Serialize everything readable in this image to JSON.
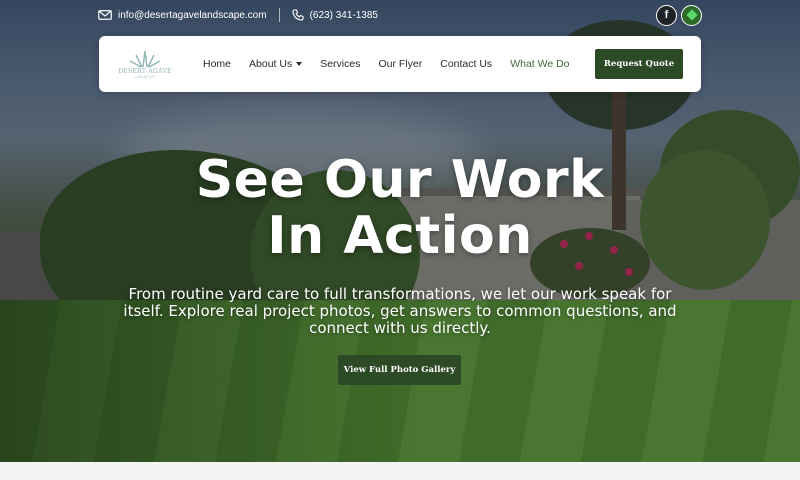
{
  "topbar": {
    "email": "info@desertagavelandscape.com",
    "phone": "(623) 341-1385",
    "icons": {
      "email": "envelope-icon",
      "phone": "phone-icon",
      "facebook": "facebook-icon",
      "google": "google-business-icon"
    },
    "facebook_glyph": "f"
  },
  "logo": {
    "title": "DESERT AGAVE",
    "subtitle": "LANDSCAPE"
  },
  "nav": {
    "items": [
      {
        "label": "Home"
      },
      {
        "label": "About Us"
      },
      {
        "label": "Services"
      },
      {
        "label": "Our Flyer"
      },
      {
        "label": "Contact Us"
      },
      {
        "label": "What We Do"
      }
    ],
    "cta": "Request Quote"
  },
  "hero": {
    "headline_line1": "See Our Work",
    "headline_line2": "In Action",
    "subtext": "From routine yard care to full transformations, we let our work speak for itself. Explore real project photos, get answers to common questions, and connect with us directly.",
    "button": "View Full Photo Gallery"
  },
  "colors": {
    "accent": "#2b4a25",
    "active_nav": "#3f6e32",
    "logo": "#8eb6b4"
  }
}
